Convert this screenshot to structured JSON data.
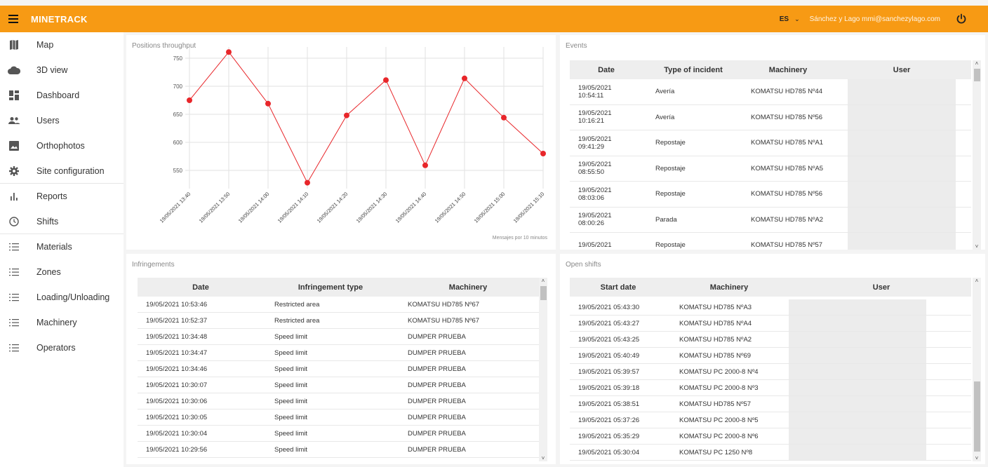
{
  "header": {
    "brand": "MINETRACK",
    "language": "ES",
    "user": "Sánchez y Lago mmi@sanchezylago.com",
    "accent": "#f79a14"
  },
  "sidebar": {
    "items": [
      {
        "label": "Map",
        "icon": "map-icon"
      },
      {
        "label": "3D view",
        "icon": "cloud-icon"
      },
      {
        "label": "Dashboard",
        "icon": "dashboard-icon"
      },
      {
        "label": "Users",
        "icon": "users-icon"
      },
      {
        "label": "Orthophotos",
        "icon": "image-icon"
      },
      {
        "label": "Site configuration",
        "icon": "gear-icon"
      },
      {
        "label": "Reports",
        "icon": "bar-chart-icon"
      },
      {
        "label": "Shifts",
        "icon": "clock-icon"
      },
      {
        "label": "Materials",
        "icon": "list-icon"
      },
      {
        "label": "Zones",
        "icon": "list-icon"
      },
      {
        "label": "Loading/Unloading",
        "icon": "list-icon"
      },
      {
        "label": "Machinery",
        "icon": "list-icon"
      },
      {
        "label": "Operators",
        "icon": "list-icon"
      }
    ]
  },
  "throughput": {
    "title": "Positions throughput",
    "footer": "Mensajes por 10 minutos"
  },
  "chart_data": {
    "type": "line",
    "categories": [
      "19/05/2021 13:40",
      "19/05/2021 13:50",
      "19/05/2021 14:00",
      "19/05/2021 14:10",
      "19/05/2021 14:20",
      "19/05/2021 14:30",
      "19/05/2021 14:40",
      "19/05/2021 14:50",
      "19/05/2021 15:00",
      "19/05/2021 15:10"
    ],
    "values": [
      675,
      761,
      669,
      528,
      648,
      711,
      559,
      714,
      644,
      580
    ],
    "yticks": [
      550,
      600,
      650,
      700,
      750
    ],
    "ylim": [
      525,
      765
    ],
    "color": "#e8262a",
    "grid": true
  },
  "events": {
    "title": "Events",
    "columns": [
      "Date",
      "Type of incident",
      "Machinery",
      "User"
    ],
    "rows": [
      {
        "date": "19/05/2021",
        "time": "10:54:11",
        "type": "Avería",
        "machine": "KOMATSU HD785 Nº44"
      },
      {
        "date": "19/05/2021",
        "time": "10:16:21",
        "type": "Avería",
        "machine": "KOMATSU HD785 Nº56"
      },
      {
        "date": "19/05/2021",
        "time": "09:41:29",
        "type": "Repostaje",
        "machine": "KOMATSU HD785 NºA1"
      },
      {
        "date": "19/05/2021",
        "time": "08:55:50",
        "type": "Repostaje",
        "machine": "KOMATSU HD785 NºA5"
      },
      {
        "date": "19/05/2021",
        "time": "08:03:06",
        "type": "Repostaje",
        "machine": "KOMATSU HD785 Nº56"
      },
      {
        "date": "19/05/2021",
        "time": "08:00:26",
        "type": "Parada",
        "machine": "KOMATSU HD785 NºA2"
      },
      {
        "date": "19/05/2021",
        "time": "",
        "type": "Repostaje",
        "machine": "KOMATSU HD785 Nº57"
      }
    ]
  },
  "infringements": {
    "title": "Infringements",
    "columns": [
      "Date",
      "Infringement type",
      "Machinery"
    ],
    "rows": [
      {
        "date": "19/05/2021 10:53:46",
        "type": "Restricted area",
        "machine": "KOMATSU HD785 Nº67"
      },
      {
        "date": "19/05/2021 10:52:37",
        "type": "Restricted area",
        "machine": "KOMATSU HD785 Nº67"
      },
      {
        "date": "19/05/2021 10:34:48",
        "type": "Speed limit",
        "machine": "DUMPER PRUEBA"
      },
      {
        "date": "19/05/2021 10:34:47",
        "type": "Speed limit",
        "machine": "DUMPER PRUEBA"
      },
      {
        "date": "19/05/2021 10:34:46",
        "type": "Speed limit",
        "machine": "DUMPER PRUEBA"
      },
      {
        "date": "19/05/2021 10:30:07",
        "type": "Speed limit",
        "machine": "DUMPER PRUEBA"
      },
      {
        "date": "19/05/2021 10:30:06",
        "type": "Speed limit",
        "machine": "DUMPER PRUEBA"
      },
      {
        "date": "19/05/2021 10:30:05",
        "type": "Speed limit",
        "machine": "DUMPER PRUEBA"
      },
      {
        "date": "19/05/2021 10:30:04",
        "type": "Speed limit",
        "machine": "DUMPER PRUEBA"
      },
      {
        "date": "19/05/2021 10:29:56",
        "type": "Speed limit",
        "machine": "DUMPER PRUEBA"
      }
    ]
  },
  "open_shifts": {
    "title": "Open shifts",
    "columns": [
      "Start date",
      "Machinery",
      "User"
    ],
    "rows": [
      {
        "date": "19/05/2021 05:43:30",
        "machine": "KOMATSU HD785 NºA3"
      },
      {
        "date": "19/05/2021 05:43:27",
        "machine": "KOMATSU HD785 NºA4"
      },
      {
        "date": "19/05/2021 05:43:25",
        "machine": "KOMATSU HD785 NºA2"
      },
      {
        "date": "19/05/2021 05:40:49",
        "machine": "KOMATSU HD785 Nº69"
      },
      {
        "date": "19/05/2021 05:39:57",
        "machine": "KOMATSU PC 2000-8 Nº4"
      },
      {
        "date": "19/05/2021 05:39:18",
        "machine": "KOMATSU PC 2000-8 Nº3"
      },
      {
        "date": "19/05/2021 05:38:51",
        "machine": "KOMATSU HD785 Nº57"
      },
      {
        "date": "19/05/2021 05:37:26",
        "machine": "KOMATSU PC 2000-8 Nº5"
      },
      {
        "date": "19/05/2021 05:35:29",
        "machine": "KOMATSU PC 2000-8 Nº6"
      },
      {
        "date": "19/05/2021 05:30:04",
        "machine": "KOMATSU PC 1250 Nº8"
      }
    ]
  }
}
